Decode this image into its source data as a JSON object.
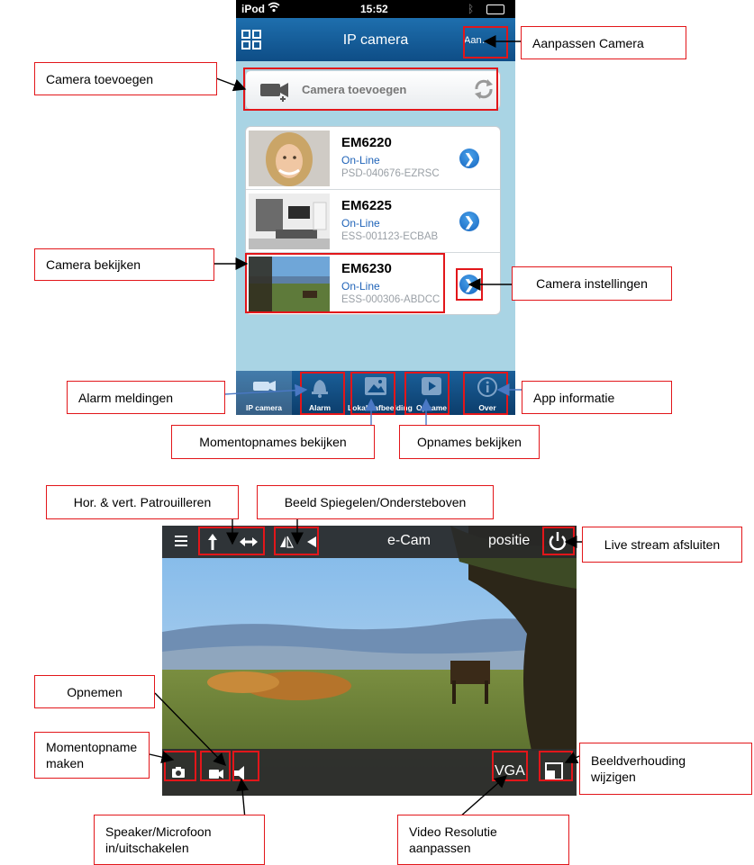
{
  "phone": {
    "status": {
      "carrier": "iPod",
      "time": "15:52"
    },
    "nav": {
      "title": "IP camera",
      "right_button": "Aan…r"
    },
    "add_camera_label": "Camera toevoegen",
    "cameras": [
      {
        "name": "EM6220",
        "status": "On-Line",
        "id": "PSD-040676-EZRSC"
      },
      {
        "name": "EM6225",
        "status": "On-Line",
        "id": "ESS-001123-ECBAB"
      },
      {
        "name": "EM6230",
        "status": "On-Line",
        "id": "ESS-000306-ABDCC"
      }
    ],
    "tabs": [
      {
        "label": "IP camera",
        "icon": "camera-icon"
      },
      {
        "label": "Alarm",
        "icon": "bell-icon"
      },
      {
        "label": "Lokale afbeelding",
        "icon": "image-icon"
      },
      {
        "label": "Opname",
        "icon": "play-icon"
      },
      {
        "label": "Over",
        "icon": "info-icon"
      }
    ]
  },
  "video": {
    "title": "e-Cam",
    "position_label": "positie",
    "resolution": "VGA"
  },
  "callouts": {
    "aanpassen_camera": "Aanpassen Camera",
    "camera_toevoegen": "Camera toevoegen",
    "camera_bekijken": "Camera bekijken",
    "camera_instellingen": "Camera instellingen",
    "alarm_meldingen": "Alarm meldingen",
    "app_informatie": "App informatie",
    "momentopnames_bekijken": "Momentopnames bekijken",
    "opnames_bekijken": "Opnames bekijken",
    "patrouilleren": "Hor. & vert. Patrouilleren",
    "spiegelen": "Beeld Spiegelen/Ondersteboven",
    "live_afsluiten": "Live stream afsluiten",
    "opnemen": "Opnemen",
    "momentopname_maken_1": "Momentopname",
    "momentopname_maken_2": "maken",
    "beeldverhouding_1": "Beeldverhouding",
    "beeldverhouding_2": "wijzigen",
    "speaker_1": "Speaker/Microfoon",
    "speaker_2": "in/uitschakelen",
    "resolutie_1": "Video Resolutie",
    "resolutie_2": "aanpassen"
  },
  "colors": {
    "annotation_red": "#e2161a",
    "nav_blue": "#0e4d86",
    "link_blue": "#1f63b8",
    "phone_bg": "#a9d4e4"
  }
}
